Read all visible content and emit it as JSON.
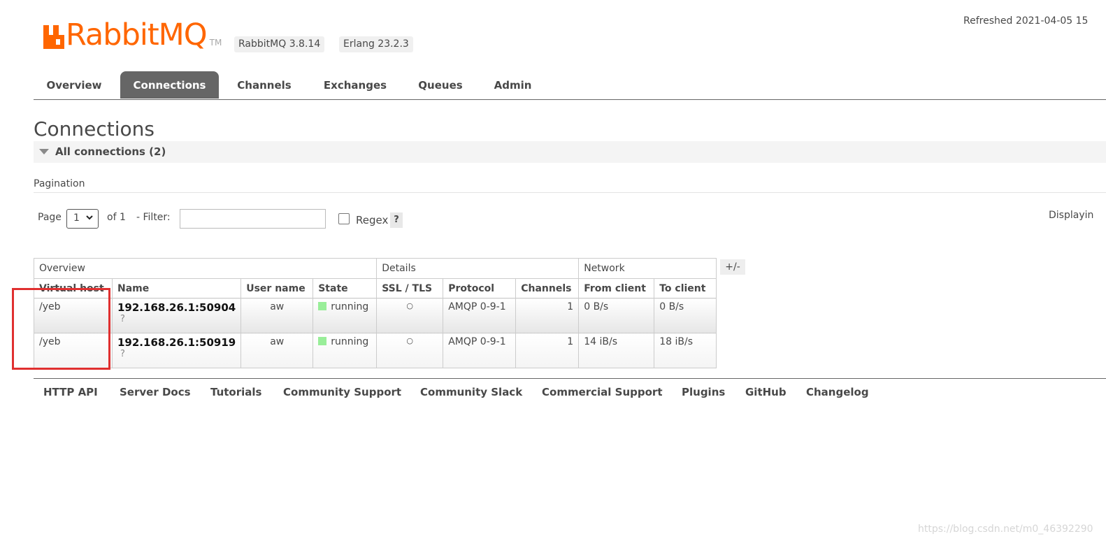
{
  "header": {
    "logo_text_orange": "RabbitMQ",
    "logo_text_gray": "",
    "logo_tm": "TM",
    "rabbitmq_version": "RabbitMQ 3.8.14",
    "erlang_version": "Erlang 23.2.3",
    "refreshed": "Refreshed 2021-04-05 15"
  },
  "tabs": [
    {
      "label": "Overview",
      "active": false
    },
    {
      "label": "Connections",
      "active": true
    },
    {
      "label": "Channels",
      "active": false
    },
    {
      "label": "Exchanges",
      "active": false
    },
    {
      "label": "Queues",
      "active": false
    },
    {
      "label": "Admin",
      "active": false
    }
  ],
  "page_title": "Connections",
  "section": {
    "label": "All connections (2)"
  },
  "pagination": {
    "label": "Pagination",
    "page_label": "Page",
    "page_value": "1",
    "of_label": "of 1",
    "filter_label": "- Filter:",
    "filter_value": "",
    "regex_label": "Regex",
    "regex_checked": false,
    "help": "?",
    "displaying": "Displayin"
  },
  "table": {
    "groups": [
      "Overview",
      "Details",
      "Network"
    ],
    "columns": [
      "Virtual host",
      "Name",
      "User name",
      "State",
      "SSL / TLS",
      "Protocol",
      "Channels",
      "From client",
      "To client"
    ],
    "columns_toggle": "+/-",
    "rows": [
      {
        "vhost": "/yeb",
        "name": "192.168.26.1:50904",
        "name_sub": "?",
        "user": "aw",
        "state": "running",
        "ssl": "○",
        "protocol": "AMQP 0-9-1",
        "channels": "1",
        "from_client": "0 B/s",
        "to_client": "0 B/s"
      },
      {
        "vhost": "/yeb",
        "name": "192.168.26.1:50919",
        "name_sub": "?",
        "user": "aw",
        "state": "running",
        "ssl": "○",
        "protocol": "AMQP 0-9-1",
        "channels": "1",
        "from_client": "14 iB/s",
        "to_client": "18 iB/s"
      }
    ]
  },
  "footer": {
    "links": [
      "HTTP API",
      "Server Docs",
      "Tutorials",
      "Community Support",
      "Community Slack",
      "Commercial Support",
      "Plugins",
      "GitHub",
      "Changelog"
    ]
  },
  "watermark": "https://blog.csdn.net/m0_46392290",
  "colors": {
    "brand_orange": "#ff6600",
    "active_tab": "#666666",
    "running_green": "#99ee99",
    "highlight_red": "#e03030"
  }
}
